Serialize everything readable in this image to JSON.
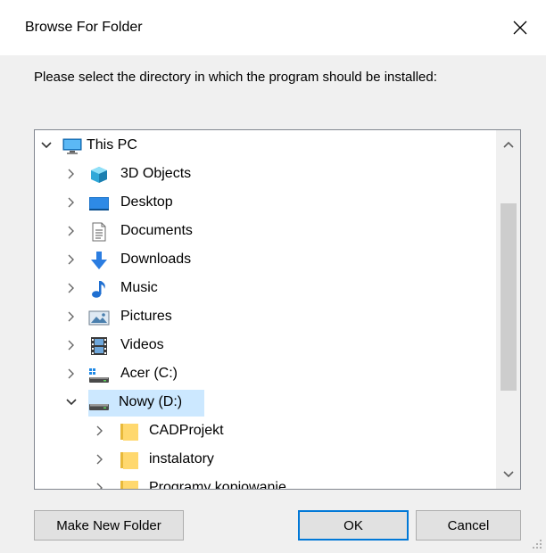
{
  "window": {
    "title": "Browse For Folder",
    "close_glyph": "✕"
  },
  "instruction": "Please select the directory in which the program should be installed:",
  "tree": {
    "items": [
      {
        "label": "This PC",
        "icon": "computer-icon",
        "expanded": true
      },
      {
        "label": "3D Objects",
        "icon": "3d-objects-icon"
      },
      {
        "label": "Desktop",
        "icon": "desktop-icon"
      },
      {
        "label": "Documents",
        "icon": "documents-icon"
      },
      {
        "label": "Downloads",
        "icon": "downloads-icon"
      },
      {
        "label": "Music",
        "icon": "music-icon"
      },
      {
        "label": "Pictures",
        "icon": "pictures-icon"
      },
      {
        "label": "Videos",
        "icon": "videos-icon"
      },
      {
        "label": "Acer (C:)",
        "icon": "system-drive-icon"
      },
      {
        "label": "Nowy (D:)",
        "icon": "drive-icon",
        "expanded": true,
        "selected": true
      },
      {
        "label": "CADProjekt",
        "icon": "folder-icon"
      },
      {
        "label": "instalatory",
        "icon": "folder-icon"
      },
      {
        "label": "Programy kopiowanie",
        "icon": "folder-icon",
        "partially_visible": true
      }
    ]
  },
  "buttons": {
    "make_new_folder": "Make New Folder",
    "ok": "OK",
    "cancel": "Cancel"
  },
  "colors": {
    "selection": "#cce8ff",
    "default_button_border": "#0078d7",
    "folder": "#ffd86e"
  }
}
